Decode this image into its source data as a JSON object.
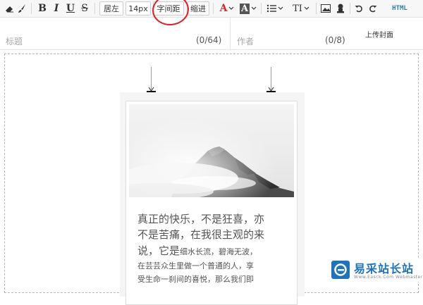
{
  "toolbar": {
    "align_left_label": "居左",
    "font_size_label": "14px",
    "letter_spacing_label": "字间距",
    "indent_label": "缩进",
    "bold_label": "B",
    "italic_label": "I",
    "underline_label": "U",
    "strike_label": "S",
    "font_color_label": "A",
    "bg_color_label": "A",
    "font_style_label": "TI",
    "html_label": "HTML",
    "accent_red": "#d9262b"
  },
  "title_row": {
    "title_placeholder": "标题",
    "title_counter": "(0/64)",
    "author_placeholder": "作者",
    "author_counter": "(0/8)",
    "cover_button": "上传封面"
  },
  "article": {
    "lines_large": [
      "真正的快乐，不是狂喜，亦",
      "不是苦痛，在我很主观的来"
    ],
    "line3_large": "说，它是",
    "line3_small": "细水长流，碧海无波，",
    "lines_small": [
      "在芸芸众生里做一个普通的人，享",
      "受生命一刹间的喜悦，那么我们即"
    ]
  },
  "watermark": {
    "site_name": "易采站长站",
    "site_url": "Www.Easck.Com Webmaster"
  }
}
